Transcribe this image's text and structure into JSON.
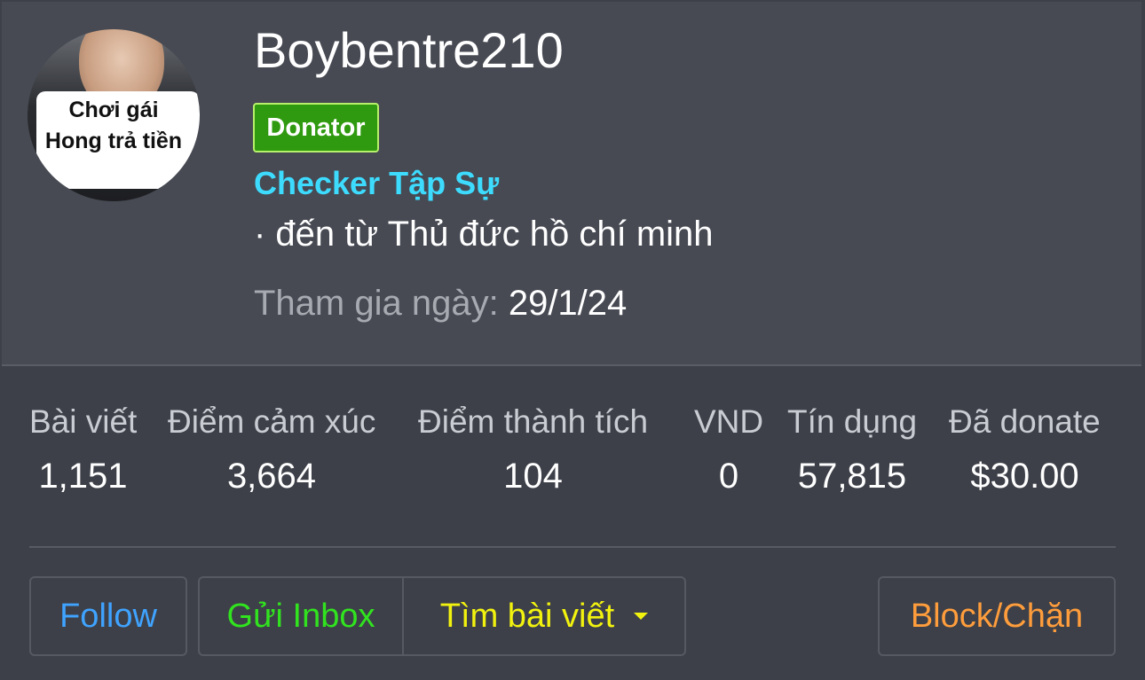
{
  "profile": {
    "username": "Boybentre210",
    "badge": "Donator",
    "rank": "Checker Tập Sự",
    "location": "· đến từ Thủ đức hồ chí minh",
    "joined_label": "Tham gia ngày:",
    "joined_value": "29/1/24",
    "avatar_text_line1": "Chơi gái",
    "avatar_text_line2": "Hong trả tiền"
  },
  "stats": [
    {
      "label": "Bài viết",
      "value": "1,151"
    },
    {
      "label": "Điểm cảm xúc",
      "value": "3,664"
    },
    {
      "label": "Điểm thành tích",
      "value": "104"
    },
    {
      "label": "VND",
      "value": "0"
    },
    {
      "label": "Tín dụng",
      "value": "57,815"
    },
    {
      "label": "Đã donate",
      "value": "$30.00"
    }
  ],
  "actions": {
    "follow": "Follow",
    "inbox": "Gửi Inbox",
    "find_posts": "Tìm bài viết",
    "block": "Block/Chặn"
  },
  "colors": {
    "badge_bg": "#2f9a0f",
    "rank": "#3ddcff",
    "follow": "#3fa3ff",
    "inbox": "#31e31f",
    "find_posts": "#f2f20f",
    "block": "#ff9d3c"
  },
  "icons": {
    "dropdown": "caret-down-icon"
  }
}
